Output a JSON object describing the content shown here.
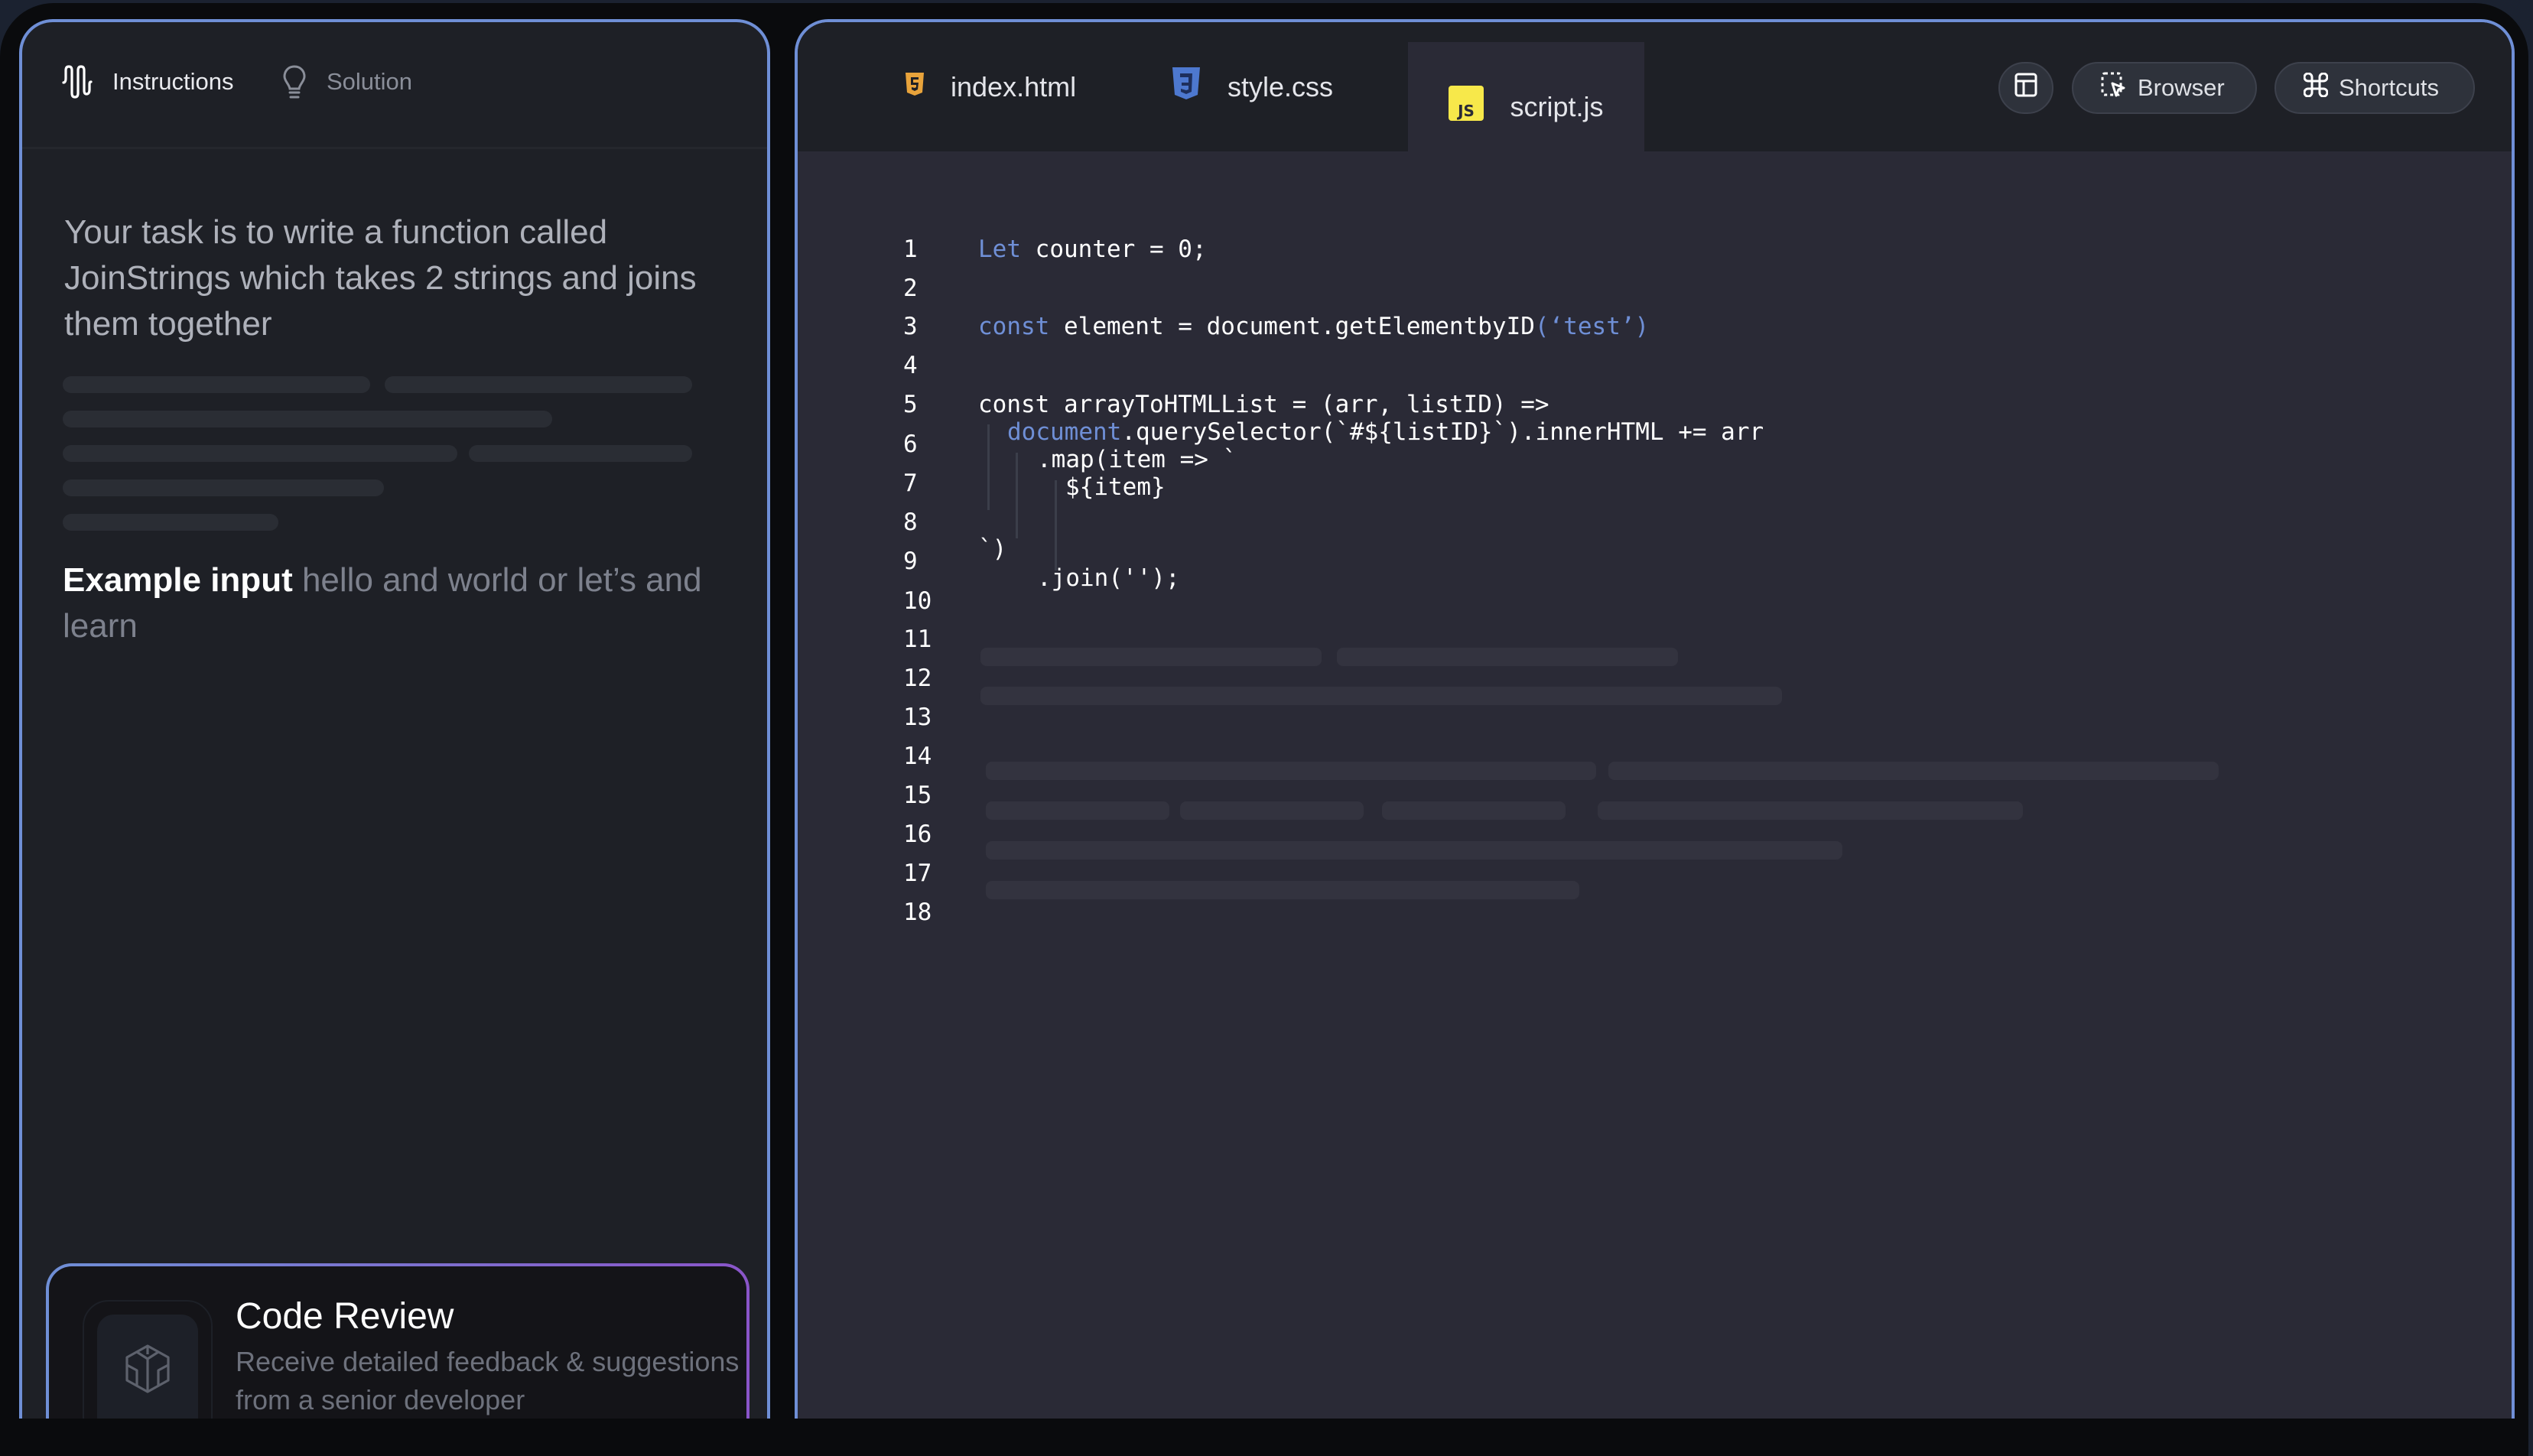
{
  "left_panel": {
    "tabs": [
      {
        "label": "Instructions",
        "icon": "waveform-icon",
        "active": true
      },
      {
        "label": "Solution",
        "icon": "lightbulb-icon",
        "active": false
      }
    ],
    "task_text": "Your task is to write a function called JoinStrings which takes 2 strings and joins them together",
    "example_label": "Example input",
    "example_text": "hello and world or let’s and learn",
    "card": {
      "icon": "cube-icon",
      "title": "Code Review",
      "description": "Receive detailed feedback & suggestions from a senior developer"
    }
  },
  "editor": {
    "tabs": [
      {
        "label": "index.html",
        "icon": "html5-icon",
        "active": false
      },
      {
        "label": "style.css",
        "icon": "css3-icon",
        "active": false
      },
      {
        "label": "script.js",
        "icon": "js-icon",
        "active": true
      }
    ],
    "toolbar": {
      "layout_icon": "layout-icon",
      "browser_label": "Browser",
      "browser_icon": "select-cursor-icon",
      "shortcuts_label": "Shortcuts",
      "shortcuts_icon": "command-icon"
    },
    "line_numbers": [
      "1",
      "2",
      "3",
      "4",
      "5",
      "6",
      "7",
      "8",
      "9",
      "10",
      "11",
      "12",
      "13",
      "14",
      "15",
      "16",
      "17",
      "18"
    ],
    "code": {
      "l1_kw": "Let",
      "l1_rest": " counter = 0;",
      "l3_kw": "const",
      "l3_rest": " element = document.getElementbyID",
      "l3_arg": "(‘test’)",
      "l5": "const arrayToHTMLList = (arr, listID) =>",
      "l6_kw": "document",
      "l6_rest": ".querySelector(`#${listID}`).innerHTML += arr",
      "l7a": ".map(item => `",
      "l7b": "${item}",
      "l9": "`)",
      "l10": ".join('');"
    }
  },
  "colors": {
    "accent": "#6f8fd6",
    "card_gradient_end": "#8a55c9",
    "html_icon": "#e8a33b",
    "css_icon": "#4d78cf",
    "js_icon": "#f7e84a"
  }
}
